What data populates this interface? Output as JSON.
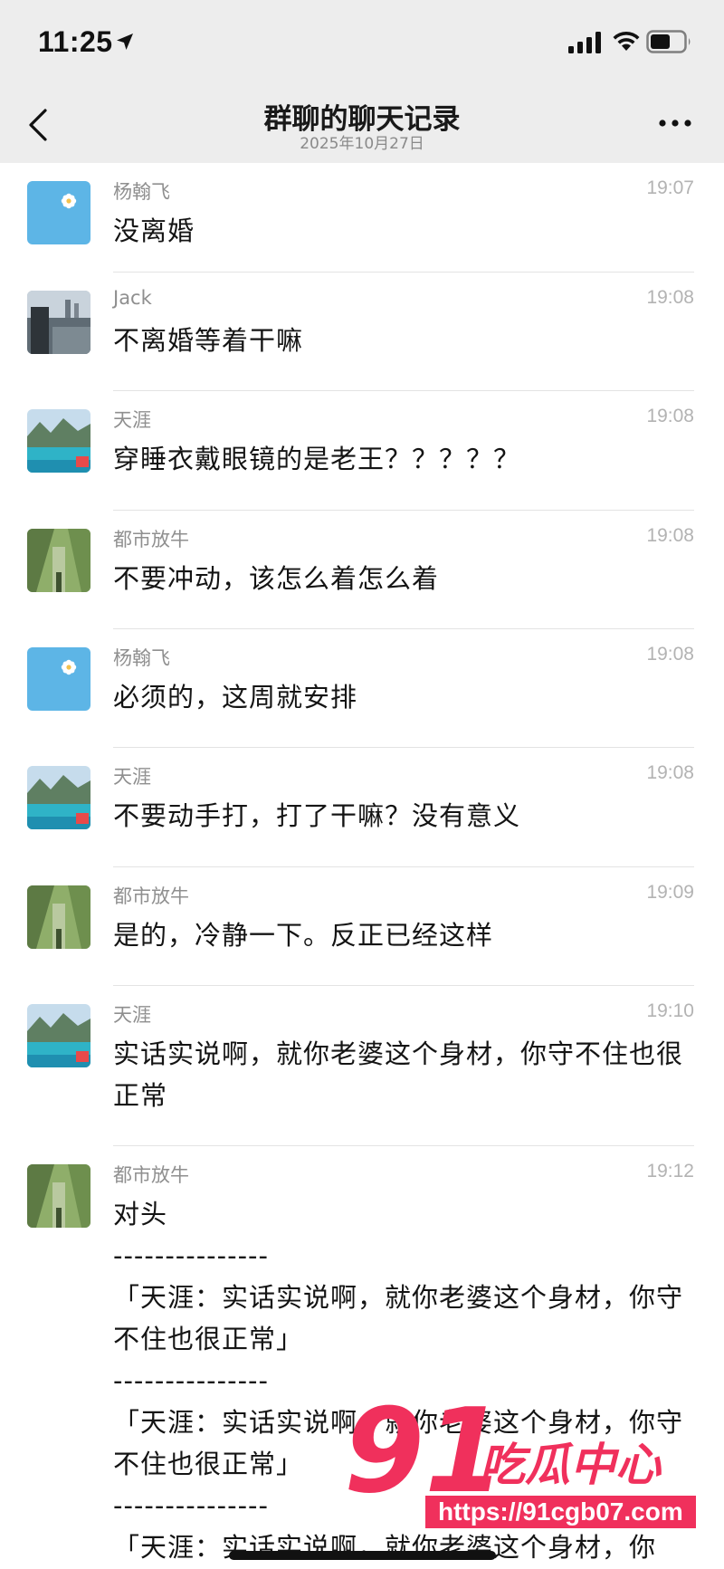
{
  "status_bar": {
    "time": "11:25"
  },
  "nav": {
    "title": "群聊的聊天记录",
    "subtitle": "2025年10月27日"
  },
  "messages": [
    {
      "sender": "杨翰飞",
      "time": "19:07",
      "text": "没离婚",
      "avatar": "flower"
    },
    {
      "sender": "Jack",
      "time": "19:08",
      "text": "不离婚等着干嘛",
      "avatar": "city"
    },
    {
      "sender": "天涯",
      "time": "19:08",
      "text": "穿睡衣戴眼镜的是老王？？？？？",
      "avatar": "lake"
    },
    {
      "sender": "都市放牛",
      "time": "19:08",
      "text": "不要冲动，该怎么着怎么着",
      "avatar": "forest"
    },
    {
      "sender": "杨翰飞",
      "time": "19:08",
      "text": "必须的，这周就安排",
      "avatar": "flower"
    },
    {
      "sender": "天涯",
      "time": "19:08",
      "text": "不要动手打，打了干嘛？没有意义",
      "avatar": "lake"
    },
    {
      "sender": "都市放牛",
      "time": "19:09",
      "text": "是的，冷静一下。反正已经这样",
      "avatar": "forest"
    },
    {
      "sender": "天涯",
      "time": "19:10",
      "text": "实话实说啊，就你老婆这个身材，你守不住也很正常",
      "avatar": "lake"
    },
    {
      "sender": "都市放牛",
      "time": "19:12",
      "text": "对头",
      "avatar": "forest",
      "separator": "---------------",
      "quotes": [
        "「天涯：实话实说啊，就你老婆这个身材，你守不住也很正常」",
        "「天涯：实话实说啊，就你老婆这个身材，你守不住也很正常」",
        "「天涯：实话实说啊，就你老婆这个身材，你"
      ]
    }
  ],
  "watermark": {
    "number": "91",
    "name": "吃瓜中心",
    "url": "https://91cgb07.com"
  },
  "colors": {
    "nav_bg": "#ededed",
    "watermark": "#f0305c",
    "avatar_flower_bg": "#5db5e6"
  }
}
